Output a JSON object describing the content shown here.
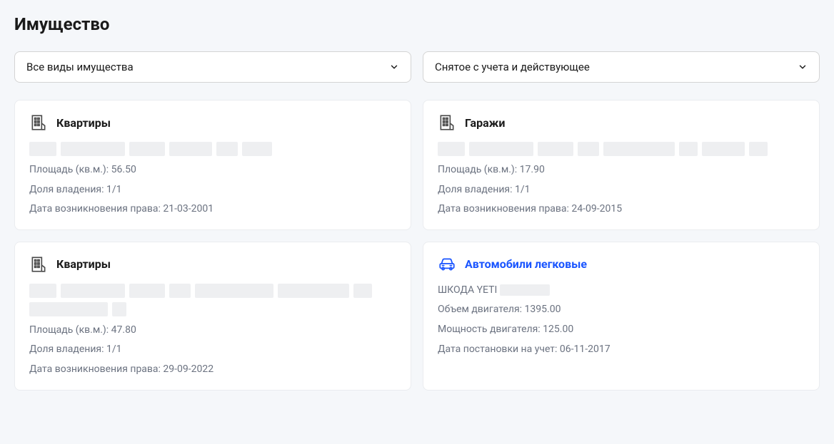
{
  "page_title": "Имущество",
  "filters": {
    "type": "Все виды имущества",
    "status": "Снятое с учета и действующее"
  },
  "cards": [
    {
      "icon": "building",
      "title": "Квартиры",
      "title_color": "default",
      "rows": [
        {
          "label": "Площадь (кв.м.):",
          "value": "56.50"
        },
        {
          "label": "Доля владения:",
          "value": "1/1"
        },
        {
          "label": "Дата возникновения права:",
          "value": "21-03-2001"
        }
      ]
    },
    {
      "icon": "building",
      "title": "Гаражи",
      "title_color": "default",
      "rows": [
        {
          "label": "Площадь (кв.м.):",
          "value": "17.90"
        },
        {
          "label": "Доля владения:",
          "value": "1/1"
        },
        {
          "label": "Дата возникновения права:",
          "value": "24-09-2015"
        }
      ]
    },
    {
      "icon": "building",
      "title": "Квартиры",
      "title_color": "default",
      "rows": [
        {
          "label": "Площадь (кв.м.):",
          "value": "47.80"
        },
        {
          "label": "Доля владения:",
          "value": "1/1"
        },
        {
          "label": "Дата возникновения права:",
          "value": "29-09-2022"
        }
      ]
    },
    {
      "icon": "car",
      "title": "Автомобили легковые",
      "title_color": "blue",
      "name_prefix": "ШКОДА YETI",
      "rows": [
        {
          "label": "Объем двигателя:",
          "value": "1395.00"
        },
        {
          "label": "Мощность двигателя:",
          "value": "125.00"
        },
        {
          "label": "Дата постановки на учет:",
          "value": "06-11-2017"
        }
      ]
    }
  ]
}
